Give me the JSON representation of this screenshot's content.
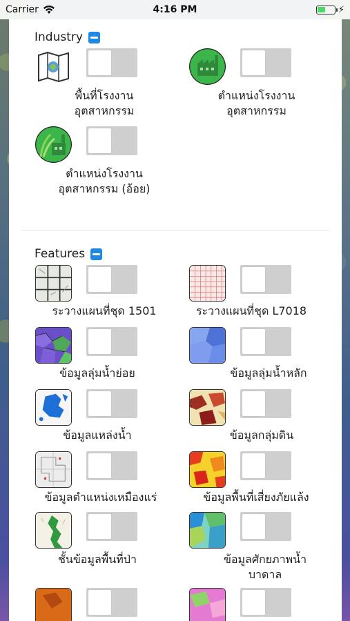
{
  "status_bar": {
    "carrier": "Carrier",
    "time": "4:16 PM",
    "battery_level": 0.45
  },
  "sections": [
    {
      "title": "Industry",
      "layers": [
        {
          "label": "พื้นที่โรงงาน\nอุตสาหกรรม",
          "icon": "factory-area-map-icon",
          "enabled": false
        },
        {
          "label": "ตำแหน่งโรงงาน\nอุตสาหกรรม",
          "icon": "factory-location-icon",
          "enabled": false
        },
        {
          "label": "ตำแหน่งโรงงาน\nอุตสาหกรรม (อ้อย)",
          "icon": "sugarcane-factory-icon",
          "enabled": false
        }
      ]
    },
    {
      "title": "Features",
      "layers": [
        {
          "label": "ระวางแผนที่ชุด 1501",
          "icon": "map-sheet-1501-icon",
          "enabled": false
        },
        {
          "label": "ระวางแผนที่ชุด L7018",
          "icon": "map-sheet-l7018-icon",
          "enabled": false
        },
        {
          "label": "ข้อมูลลุ่มน้ำย่อย",
          "icon": "sub-watershed-icon",
          "enabled": false
        },
        {
          "label": "ข้อมูลลุ่มน้ำหลัก",
          "icon": "main-watershed-icon",
          "enabled": false
        },
        {
          "label": "ข้อมูลแหล่งน้ำ",
          "icon": "water-source-icon",
          "enabled": false
        },
        {
          "label": "ข้อมูลกลุ่มดิน",
          "icon": "soil-group-icon",
          "enabled": false
        },
        {
          "label": "ข้อมูลตำแหน่งเหมืองแร่",
          "icon": "mine-location-icon",
          "enabled": false
        },
        {
          "label": "ข้อมูลพื้นที่เสี่ยงภัยแล้ง",
          "icon": "drought-risk-icon",
          "enabled": false
        },
        {
          "label": "ชั้นข้อมูลพื้นที่ป่า",
          "icon": "forest-area-icon",
          "enabled": false
        },
        {
          "label": "ข้อมูลศักยภาพน้ำ\nบาดาล",
          "icon": "groundwater-potential-icon",
          "enabled": false
        },
        {
          "label": "",
          "icon": "orange-map-icon",
          "enabled": false
        },
        {
          "label": "",
          "icon": "pink-map-icon",
          "enabled": false
        }
      ]
    }
  ]
}
